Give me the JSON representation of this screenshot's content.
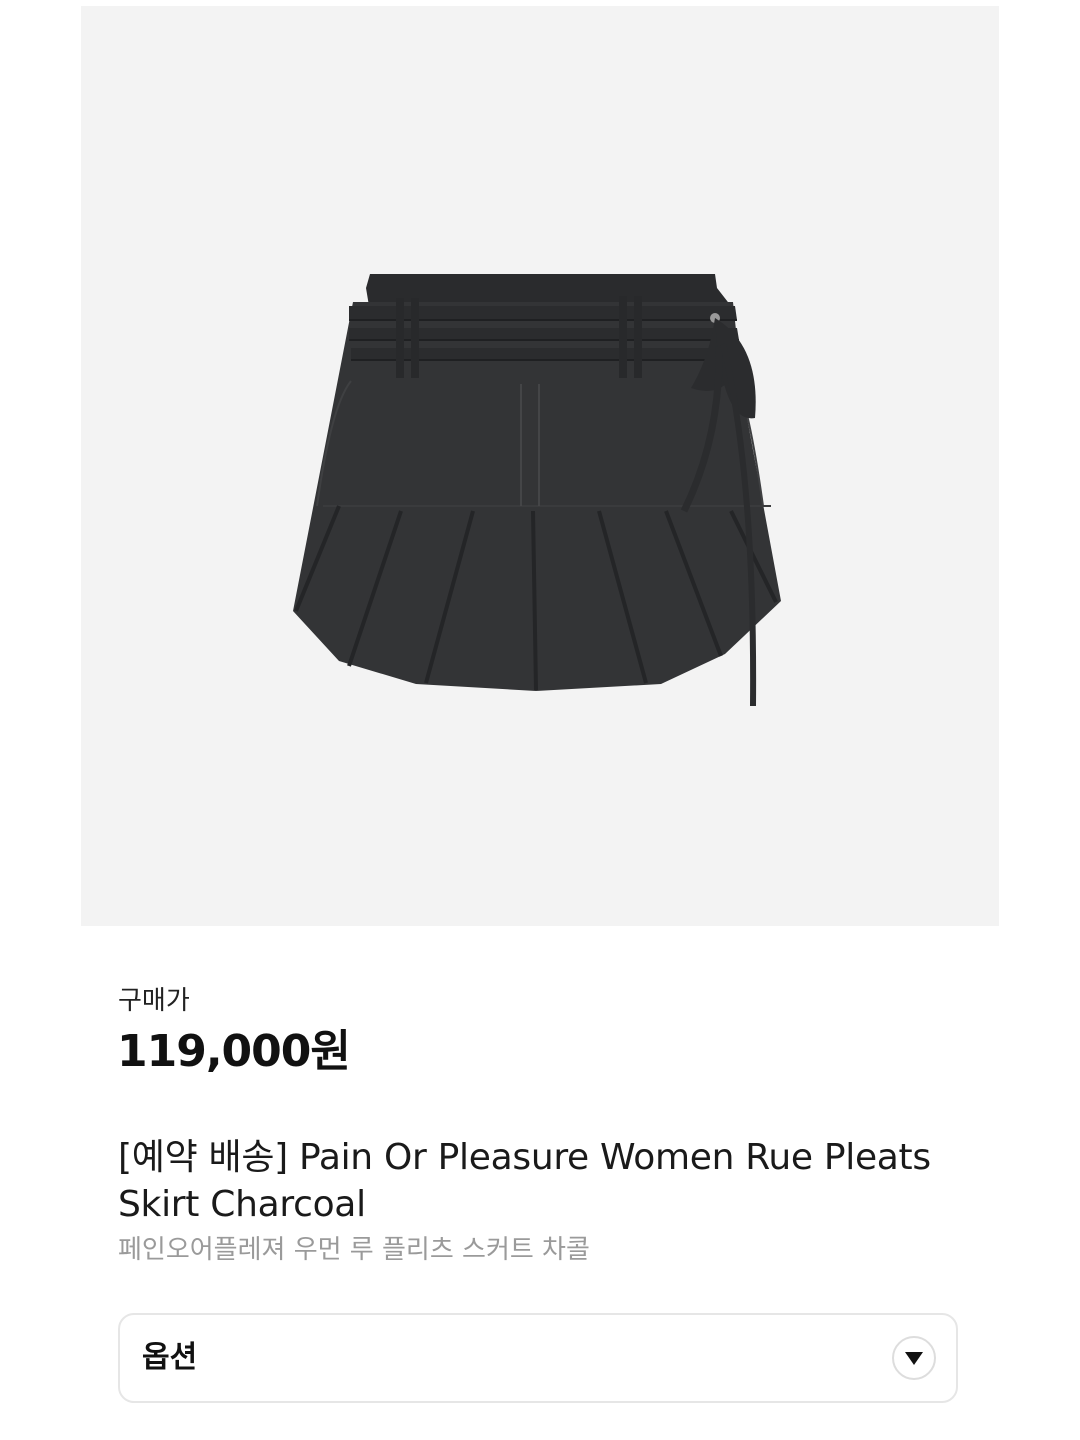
{
  "product": {
    "image_icon": "pleated-mini-skirt-photo",
    "image_background": "#f3f3f3",
    "skirt_color": "#2f3032",
    "price_label": "구매가",
    "price": "119,000원",
    "title": "[예약 배송] Pain Or Pleasure Women Rue Pleats Skirt Charcoal",
    "subtitle": "페인오어플레져 우먼 루 플리츠 스커트 차콜"
  },
  "option_select": {
    "label": "옵션",
    "icon": "chevron-down-icon"
  }
}
